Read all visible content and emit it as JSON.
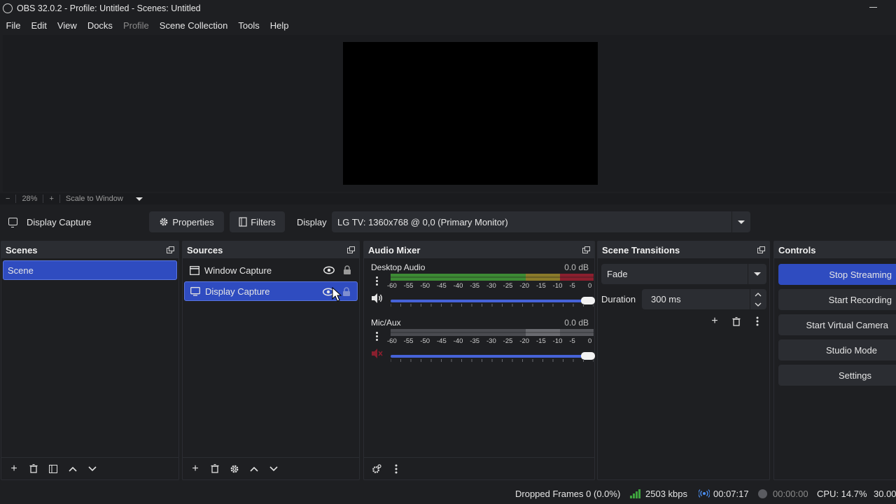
{
  "window": {
    "title": "OBS 32.0.2 - Profile: Untitled - Scenes: Untitled"
  },
  "menu": [
    "File",
    "Edit",
    "View",
    "Docks",
    "Profile",
    "Scene Collection",
    "Tools",
    "Help"
  ],
  "menu_disabled": [
    "Profile"
  ],
  "zoom": {
    "minus": "−",
    "level": "28%",
    "plus": "+",
    "scale_mode": "Scale to Window"
  },
  "source_toolbar": {
    "source_name": "Display Capture",
    "properties_label": "Properties",
    "filters_label": "Filters",
    "display_label": "Display",
    "display_value": "LG TV: 1360x768 @ 0,0 (Primary Monitor)"
  },
  "scenes": {
    "title": "Scenes",
    "items": [
      "Scene"
    ]
  },
  "sources": {
    "title": "Sources",
    "items": [
      "Window Capture",
      "Display Capture"
    ]
  },
  "mixer": {
    "title": "Audio Mixer",
    "channels": [
      {
        "name": "Desktop Audio",
        "db": "0.0 dB",
        "muted": false,
        "volume": 1.0
      },
      {
        "name": "Mic/Aux",
        "db": "0.0 dB",
        "muted": true,
        "volume": 1.0
      }
    ],
    "ticks": [
      "-60",
      "-55",
      "-50",
      "-45",
      "-40",
      "-35",
      "-30",
      "-25",
      "-20",
      "-15",
      "-10",
      "-5",
      "0"
    ]
  },
  "transitions": {
    "title": "Scene Transitions",
    "selected": "Fade",
    "duration_label": "Duration",
    "duration_value": "300 ms"
  },
  "controls": {
    "title": "Controls",
    "buttons": [
      "Stop Streaming",
      "Start Recording",
      "Start Virtual Camera",
      "Studio Mode",
      "Settings"
    ]
  },
  "status": {
    "dropped_frames": "Dropped Frames 0 (0.0%)",
    "bitrate": "2503 kbps",
    "stream_time": "00:07:17",
    "record_time": "00:00:00",
    "cpu": "CPU: 14.7%",
    "fps": "30.00"
  },
  "colors": {
    "accent": "#2f4cc0",
    "meter_green": "#3d8a34",
    "meter_yellow": "#8a7a2a",
    "meter_red": "#8a1f2e"
  }
}
